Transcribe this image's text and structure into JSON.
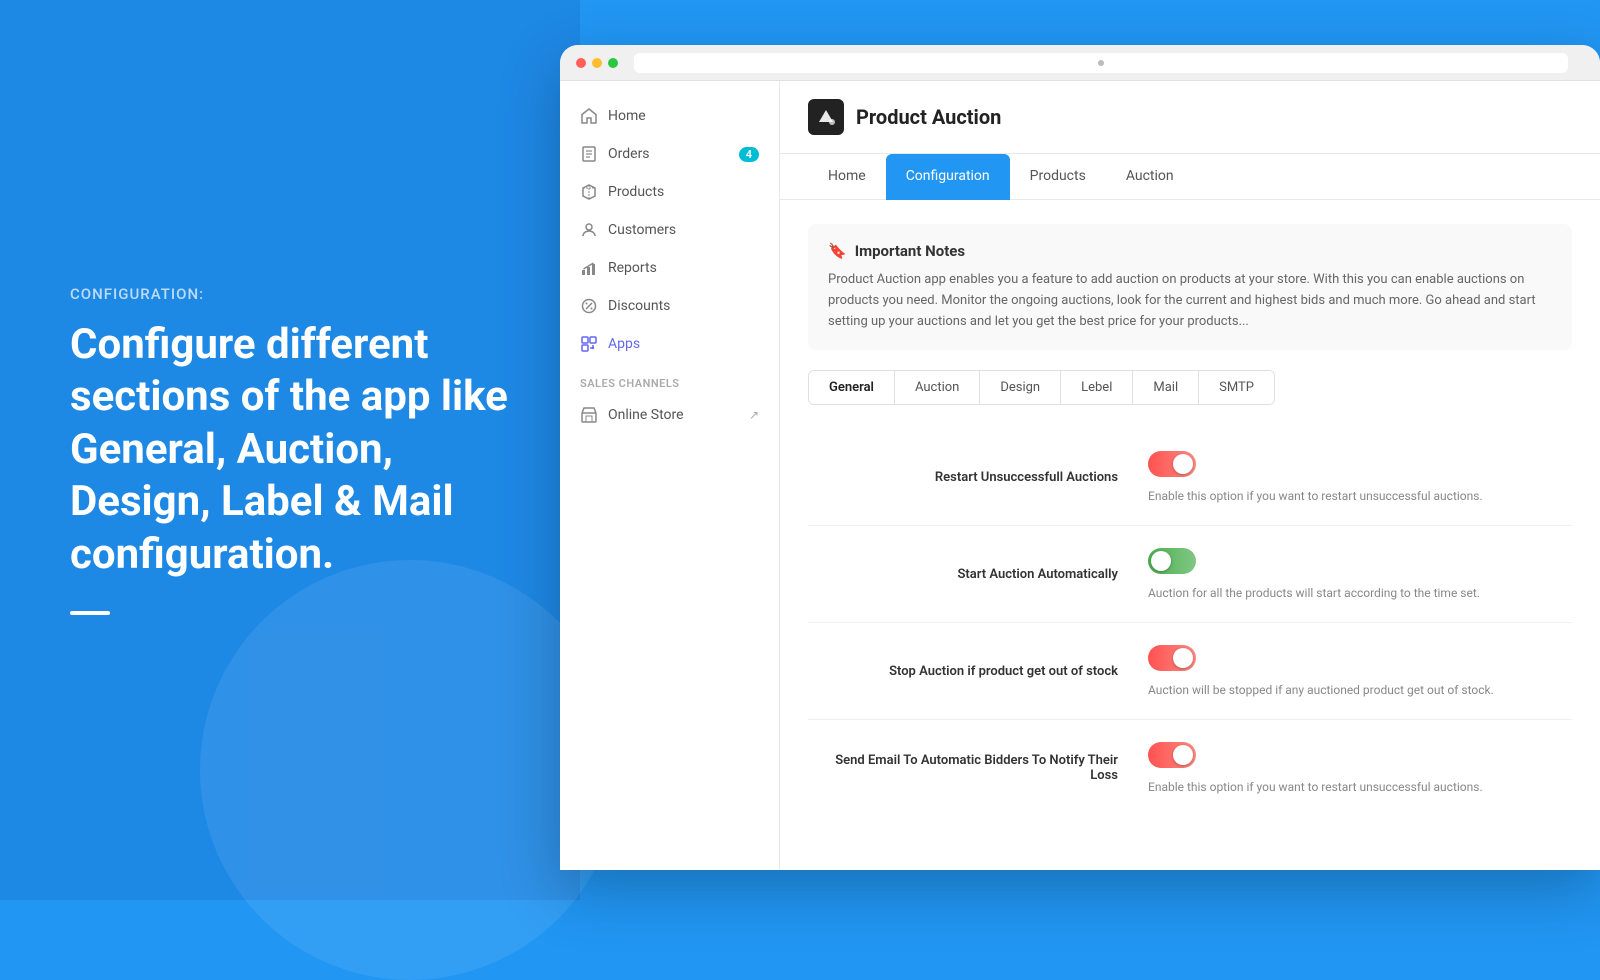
{
  "left": {
    "label": "CONFIGURATION:",
    "heading": "Configure different sections of the app like General, Auction, Design, Label & Mail configuration."
  },
  "browser": {
    "url": ""
  },
  "sidebar": {
    "items": [
      {
        "id": "home",
        "label": "Home",
        "icon": "home",
        "badge": null,
        "active": false
      },
      {
        "id": "orders",
        "label": "Orders",
        "icon": "orders",
        "badge": "4",
        "active": false
      },
      {
        "id": "products",
        "label": "Products",
        "icon": "products",
        "badge": null,
        "active": false
      },
      {
        "id": "customers",
        "label": "Customers",
        "icon": "customers",
        "badge": null,
        "active": false
      },
      {
        "id": "reports",
        "label": "Reports",
        "icon": "reports",
        "badge": null,
        "active": false
      },
      {
        "id": "discounts",
        "label": "Discounts",
        "icon": "discounts",
        "badge": null,
        "active": false
      },
      {
        "id": "apps",
        "label": "Apps",
        "icon": "apps",
        "badge": null,
        "active": true
      }
    ],
    "sales_channels_label": "SALES CHANNELS",
    "sales_channels": [
      {
        "id": "online-store",
        "label": "Online Store",
        "icon": "store",
        "ext": true
      }
    ]
  },
  "app": {
    "title": "Product Auction",
    "tabs": [
      {
        "id": "home",
        "label": "Home",
        "active": false
      },
      {
        "id": "configuration",
        "label": "Configuration",
        "active": true
      },
      {
        "id": "products",
        "label": "Products",
        "active": false
      },
      {
        "id": "auction",
        "label": "Auction",
        "active": false
      }
    ]
  },
  "important_notes": {
    "title": "Important Notes",
    "text": "Product Auction app enables you a feature to add auction on products at your store. With this you can enable auctions on products you need. Monitor the ongoing auctions, look for the current and highest bids and much more. Go ahead and start setting up your auctions and let you get the best price for your products..."
  },
  "sub_tabs": [
    {
      "id": "general",
      "label": "General",
      "active": true
    },
    {
      "id": "auction",
      "label": "Auction",
      "active": false
    },
    {
      "id": "design",
      "label": "Design",
      "active": false
    },
    {
      "id": "lebel",
      "label": "Lebel",
      "active": false
    },
    {
      "id": "mail",
      "label": "Mail",
      "active": false
    },
    {
      "id": "smtp",
      "label": "SMTP",
      "active": false
    }
  ],
  "settings": [
    {
      "id": "restart-unsuccessful",
      "label": "Restart Unsuccessfull Auctions",
      "toggle": "off",
      "description": "Enable this option if you want to restart unsuccessful auctions."
    },
    {
      "id": "start-automatically",
      "label": "Start Auction Automatically",
      "toggle": "on",
      "description": "Auction for all the products will start according to the time set."
    },
    {
      "id": "stop-out-of-stock",
      "label": "Stop Auction if product get out of stock",
      "toggle": "off",
      "description": "Auction will be stopped if any auctioned product get out of stock."
    },
    {
      "id": "send-email",
      "label": "Send Email To Automatic Bidders To Notify Their Loss",
      "toggle": "off",
      "description": "Enable this option if you want to restart unsuccessful auctions."
    }
  ]
}
